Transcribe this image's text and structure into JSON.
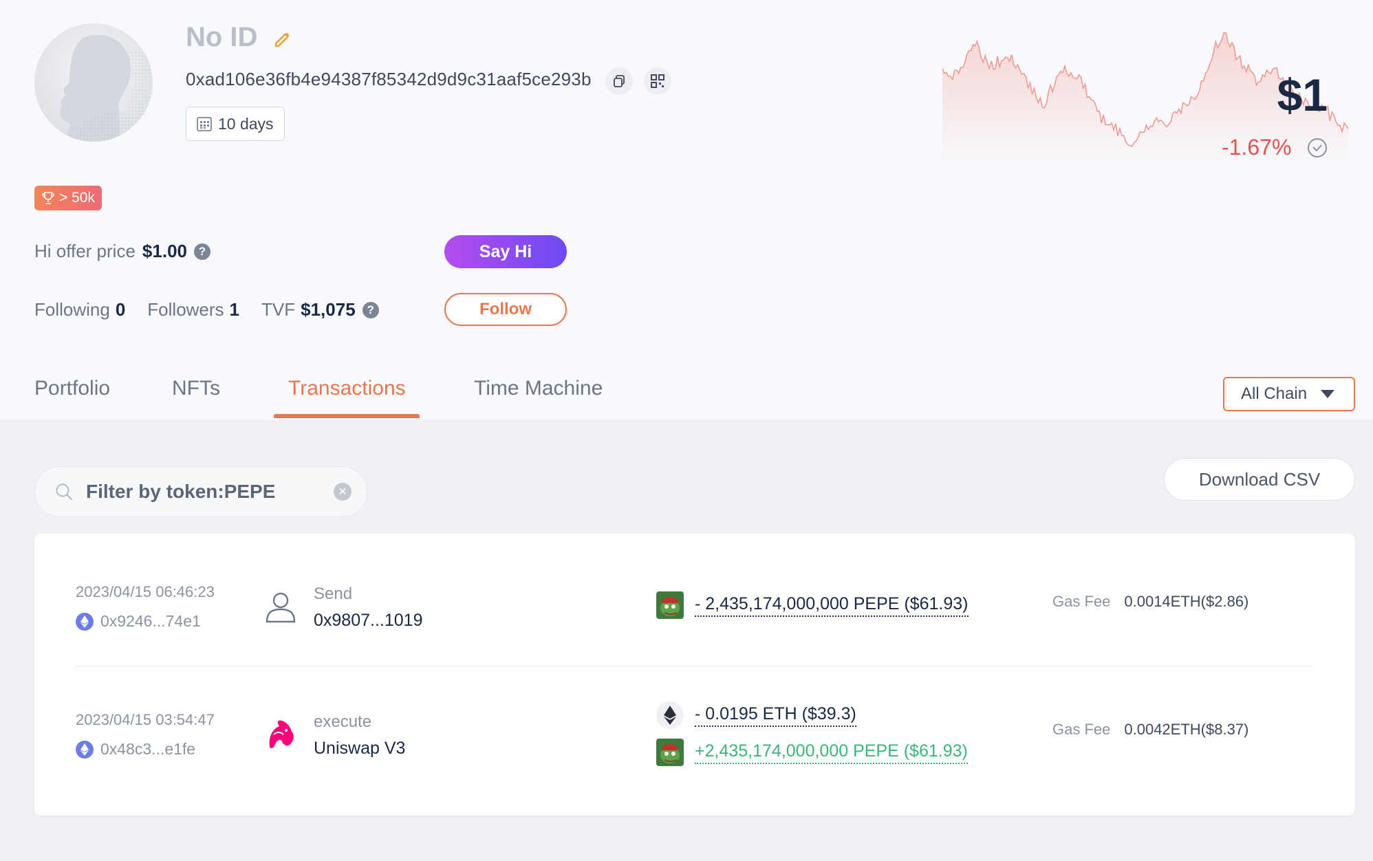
{
  "profile": {
    "name": "No ID",
    "address": "0xad106e36fb4e94387f85342d9d9c31aaf5ce293b",
    "age": "10 days",
    "badge": "> 50k",
    "balance": "$1",
    "change": "-1.67%"
  },
  "offer": {
    "label": "Hi offer price",
    "value": "$1.00"
  },
  "stats": {
    "following_label": "Following",
    "following": "0",
    "followers_label": "Followers",
    "followers": "1",
    "tvf_label": "TVF",
    "tvf": "$1,075"
  },
  "buttons": {
    "say_hi": "Say Hi",
    "follow": "Follow",
    "download_csv": "Download CSV"
  },
  "tabs": [
    {
      "label": "Portfolio",
      "active": false
    },
    {
      "label": "NFTs",
      "active": false
    },
    {
      "label": "Transactions",
      "active": true
    },
    {
      "label": "Time Machine",
      "active": false
    }
  ],
  "chain_filter": {
    "selected": "All Chain"
  },
  "search": {
    "value": "Filter by token:PEPE"
  },
  "transactions": [
    {
      "time": "2023/04/15 06:46:23",
      "hash": "0x9246...74e1",
      "type": "Send",
      "target": "0x9807...1019",
      "icon": "user-icon",
      "tokens": [
        {
          "icon": "pepe-token-icon",
          "amount": "- 2,435,174,000,000 PEPE ($61.93)",
          "direction": "out"
        }
      ],
      "gas_label": "Gas Fee",
      "gas": "0.0014ETH($2.86)"
    },
    {
      "time": "2023/04/15 03:54:47",
      "hash": "0x48c3...e1fe",
      "type": "execute",
      "target": "Uniswap V3",
      "icon": "uniswap-icon",
      "tokens": [
        {
          "icon": "eth-token-icon",
          "amount": "- 0.0195 ETH ($39.3)",
          "direction": "out"
        },
        {
          "icon": "pepe-token-icon",
          "amount": "+2,435,174,000,000 PEPE ($61.93)",
          "direction": "in"
        }
      ],
      "gas_label": "Gas Fee",
      "gas": "0.0042ETH($8.37)"
    }
  ],
  "colors": {
    "accent": "#e9764f",
    "negative": "#e0534f",
    "positive": "#3bb57a",
    "purple": "#8a4cf2"
  }
}
